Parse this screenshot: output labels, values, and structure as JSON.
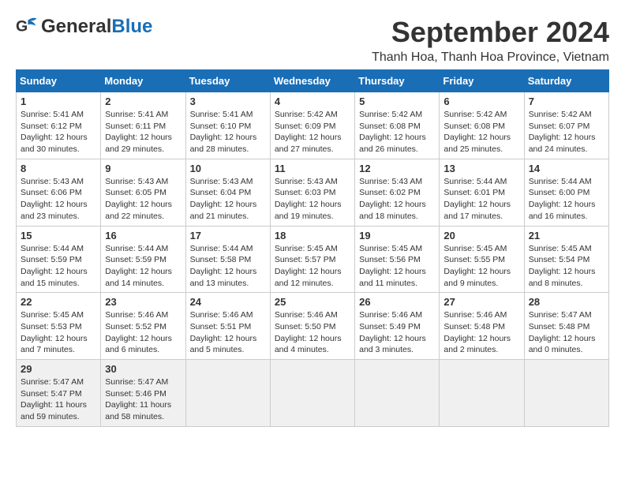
{
  "header": {
    "logo_general": "General",
    "logo_blue": "Blue",
    "month_title": "September 2024",
    "subtitle": "Thanh Hoa, Thanh Hoa Province, Vietnam"
  },
  "days_of_week": [
    "Sunday",
    "Monday",
    "Tuesday",
    "Wednesday",
    "Thursday",
    "Friday",
    "Saturday"
  ],
  "weeks": [
    [
      {
        "day": "1",
        "sunrise": "Sunrise: 5:41 AM",
        "sunset": "Sunset: 6:12 PM",
        "daylight": "Daylight: 12 hours and 30 minutes."
      },
      {
        "day": "2",
        "sunrise": "Sunrise: 5:41 AM",
        "sunset": "Sunset: 6:11 PM",
        "daylight": "Daylight: 12 hours and 29 minutes."
      },
      {
        "day": "3",
        "sunrise": "Sunrise: 5:41 AM",
        "sunset": "Sunset: 6:10 PM",
        "daylight": "Daylight: 12 hours and 28 minutes."
      },
      {
        "day": "4",
        "sunrise": "Sunrise: 5:42 AM",
        "sunset": "Sunset: 6:09 PM",
        "daylight": "Daylight: 12 hours and 27 minutes."
      },
      {
        "day": "5",
        "sunrise": "Sunrise: 5:42 AM",
        "sunset": "Sunset: 6:08 PM",
        "daylight": "Daylight: 12 hours and 26 minutes."
      },
      {
        "day": "6",
        "sunrise": "Sunrise: 5:42 AM",
        "sunset": "Sunset: 6:08 PM",
        "daylight": "Daylight: 12 hours and 25 minutes."
      },
      {
        "day": "7",
        "sunrise": "Sunrise: 5:42 AM",
        "sunset": "Sunset: 6:07 PM",
        "daylight": "Daylight: 12 hours and 24 minutes."
      }
    ],
    [
      {
        "day": "8",
        "sunrise": "Sunrise: 5:43 AM",
        "sunset": "Sunset: 6:06 PM",
        "daylight": "Daylight: 12 hours and 23 minutes."
      },
      {
        "day": "9",
        "sunrise": "Sunrise: 5:43 AM",
        "sunset": "Sunset: 6:05 PM",
        "daylight": "Daylight: 12 hours and 22 minutes."
      },
      {
        "day": "10",
        "sunrise": "Sunrise: 5:43 AM",
        "sunset": "Sunset: 6:04 PM",
        "daylight": "Daylight: 12 hours and 21 minutes."
      },
      {
        "day": "11",
        "sunrise": "Sunrise: 5:43 AM",
        "sunset": "Sunset: 6:03 PM",
        "daylight": "Daylight: 12 hours and 19 minutes."
      },
      {
        "day": "12",
        "sunrise": "Sunrise: 5:43 AM",
        "sunset": "Sunset: 6:02 PM",
        "daylight": "Daylight: 12 hours and 18 minutes."
      },
      {
        "day": "13",
        "sunrise": "Sunrise: 5:44 AM",
        "sunset": "Sunset: 6:01 PM",
        "daylight": "Daylight: 12 hours and 17 minutes."
      },
      {
        "day": "14",
        "sunrise": "Sunrise: 5:44 AM",
        "sunset": "Sunset: 6:00 PM",
        "daylight": "Daylight: 12 hours and 16 minutes."
      }
    ],
    [
      {
        "day": "15",
        "sunrise": "Sunrise: 5:44 AM",
        "sunset": "Sunset: 5:59 PM",
        "daylight": "Daylight: 12 hours and 15 minutes."
      },
      {
        "day": "16",
        "sunrise": "Sunrise: 5:44 AM",
        "sunset": "Sunset: 5:59 PM",
        "daylight": "Daylight: 12 hours and 14 minutes."
      },
      {
        "day": "17",
        "sunrise": "Sunrise: 5:44 AM",
        "sunset": "Sunset: 5:58 PM",
        "daylight": "Daylight: 12 hours and 13 minutes."
      },
      {
        "day": "18",
        "sunrise": "Sunrise: 5:45 AM",
        "sunset": "Sunset: 5:57 PM",
        "daylight": "Daylight: 12 hours and 12 minutes."
      },
      {
        "day": "19",
        "sunrise": "Sunrise: 5:45 AM",
        "sunset": "Sunset: 5:56 PM",
        "daylight": "Daylight: 12 hours and 11 minutes."
      },
      {
        "day": "20",
        "sunrise": "Sunrise: 5:45 AM",
        "sunset": "Sunset: 5:55 PM",
        "daylight": "Daylight: 12 hours and 9 minutes."
      },
      {
        "day": "21",
        "sunrise": "Sunrise: 5:45 AM",
        "sunset": "Sunset: 5:54 PM",
        "daylight": "Daylight: 12 hours and 8 minutes."
      }
    ],
    [
      {
        "day": "22",
        "sunrise": "Sunrise: 5:45 AM",
        "sunset": "Sunset: 5:53 PM",
        "daylight": "Daylight: 12 hours and 7 minutes."
      },
      {
        "day": "23",
        "sunrise": "Sunrise: 5:46 AM",
        "sunset": "Sunset: 5:52 PM",
        "daylight": "Daylight: 12 hours and 6 minutes."
      },
      {
        "day": "24",
        "sunrise": "Sunrise: 5:46 AM",
        "sunset": "Sunset: 5:51 PM",
        "daylight": "Daylight: 12 hours and 5 minutes."
      },
      {
        "day": "25",
        "sunrise": "Sunrise: 5:46 AM",
        "sunset": "Sunset: 5:50 PM",
        "daylight": "Daylight: 12 hours and 4 minutes."
      },
      {
        "day": "26",
        "sunrise": "Sunrise: 5:46 AM",
        "sunset": "Sunset: 5:49 PM",
        "daylight": "Daylight: 12 hours and 3 minutes."
      },
      {
        "day": "27",
        "sunrise": "Sunrise: 5:46 AM",
        "sunset": "Sunset: 5:48 PM",
        "daylight": "Daylight: 12 hours and 2 minutes."
      },
      {
        "day": "28",
        "sunrise": "Sunrise: 5:47 AM",
        "sunset": "Sunset: 5:48 PM",
        "daylight": "Daylight: 12 hours and 0 minutes."
      }
    ],
    [
      {
        "day": "29",
        "sunrise": "Sunrise: 5:47 AM",
        "sunset": "Sunset: 5:47 PM",
        "daylight": "Daylight: 11 hours and 59 minutes."
      },
      {
        "day": "30",
        "sunrise": "Sunrise: 5:47 AM",
        "sunset": "Sunset: 5:46 PM",
        "daylight": "Daylight: 11 hours and 58 minutes."
      },
      null,
      null,
      null,
      null,
      null
    ]
  ]
}
